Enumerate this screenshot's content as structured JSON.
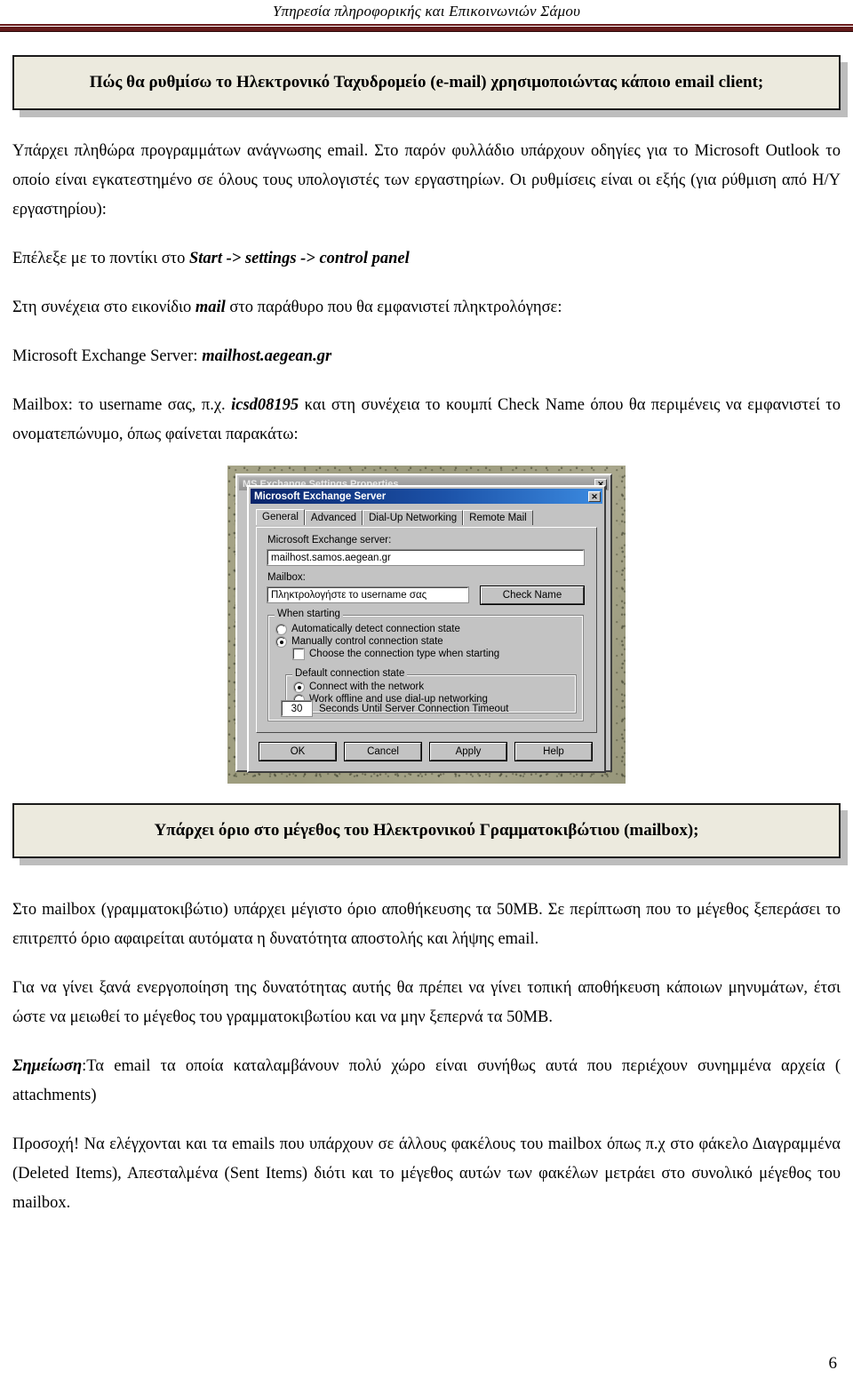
{
  "header": {
    "running_title": "Υπηρεσία πληροφορικής και Επικοινωνιών Σάμου"
  },
  "callout1": {
    "text": "Πώς θα ρυθμίσω το Ηλεκτρονικό Ταχυδρομείο (e-mail) χρησιμοποιώντας κάποιο email client;"
  },
  "callout2": {
    "text": "Υπάρχει όριο στο μέγεθος του Ηλεκτρονικού Γραμματοκιβώτιου (mailbox);"
  },
  "intro": {
    "p1_a": "Υπάρχει πληθώρα προγραμμάτων ανάγνωσης email. Στο παρόν φυλλάδιο υπάρχουν οδηγίες για το Microsoft Outlook το οποίο είναι εγκατεστημένο σε όλους τους υπολογιστές των εργαστηρίων. Οι ρυθμίσεις είναι οι εξής (για ρύθμιση από Η/Υ εργαστηρίου):",
    "p2_a": "Επέλεξε με το ποντίκι στο ",
    "p2_b": "Start -> settings -> control panel",
    "p3_a": "Στη συνέχεια στο εικονίδιο ",
    "p3_b": "mail",
    "p3_c": "  στο παράθυρο που θα εμφανιστεί πληκτρολόγησε:",
    "p4_a": "Microsoft Exchange Server: ",
    "p4_b": "mailhost.aegean.gr",
    "p5_a": "Mailbox: ",
    "p5_b": "το username σας, π.χ. ",
    "p5_c": "icsd08195",
    "p5_d": " και στη συνέχεια το κουμπί ",
    "p5_e": "Check Name",
    "p5_f": " όπου θα περιμένεις να εμφανιστεί το ονοματεπώνυμο, όπως φαίνεται παρακάτω:"
  },
  "dialog": {
    "back_window_title": "MS Exchange Settings Properties",
    "back_close_glyph": "✕",
    "front_window_title": "Microsoft Exchange Server",
    "front_close_glyph": "✕",
    "tabs": [
      {
        "label": "General",
        "active": true
      },
      {
        "label": "Advanced",
        "active": false
      },
      {
        "label": "Dial-Up Networking",
        "active": false
      },
      {
        "label": "Remote Mail",
        "active": false
      }
    ],
    "server_label": "Microsoft Exchange server:",
    "server_value": "mailhost.samos.aegean.gr",
    "mailbox_label": "Mailbox:",
    "mailbox_value": "Πληκτρολογήστε το username σας",
    "check_name_button": "Check Name",
    "when_starting_legend": "When starting",
    "radio_auto_detect": "Automatically detect connection state",
    "radio_manual": "Manually control connection state",
    "checkbox_choose_type": "Choose the connection type when starting",
    "default_state_legend": "Default connection state",
    "radio_connect_network": "Connect with the network",
    "radio_work_offline": "Work offline and use dial-up networking",
    "timeout_value": "30",
    "timeout_label": "Seconds Until Server Connection Timeout",
    "buttons": {
      "ok": "OK",
      "cancel": "Cancel",
      "apply": "Apply",
      "help": "Help"
    }
  },
  "mailbox_section": {
    "p1_a": "Στο mailbox (γραμματοκιβώτιο) υπάρχει μέγιστο όριο αποθήκευσης  τα ",
    "p1_b": "50MB",
    "p1_c": ". Σε περίπτωση που το μέγεθος ξεπεράσει το επιτρεπτό όριο ",
    "p1_d": "αφαιρείται αυτόματα η δυνατότητα αποστολής και λήψης email",
    "p1_e": ".",
    "p2_a": "Για να γίνει ξανά ενεργοποίηση της δυνατότητας αυτής θα πρέπει να γίνει τοπική αποθήκευση κάποιων μηνυμάτων, έτσι ώστε να μειωθεί το μέγεθος του γραμματοκιβωτίου και να μην ξεπερνά τα ",
    "p2_b": "50MB",
    "p2_c": ".",
    "note_label": "Σημείωση",
    "note_text": ":Τα email τα οποία καταλαμβάνουν πολύ χώρο είναι συνήθως αυτά που περιέχουν συνημμένα αρχεία ( attachments)",
    "warn_label": "Προσοχή!",
    "warn_text": " Να ελέγχονται και τα emails που υπάρχουν σε άλλους φακέλους του mailbox όπως π.χ στο φάκελο Διαγραμμένα (Deleted Items), Απεσταλμένα (Sent Items) διότι και το μέγεθος αυτών των φακέλων μετράει στο συνολικό μέγεθος του mailbox."
  },
  "footer": {
    "page_number": "6"
  },
  "colors": {
    "rule": "#641b1b",
    "callout_fill": "#eceade",
    "titlebar_active": "#0a246a",
    "dialog_face": "#c3c3c3"
  }
}
